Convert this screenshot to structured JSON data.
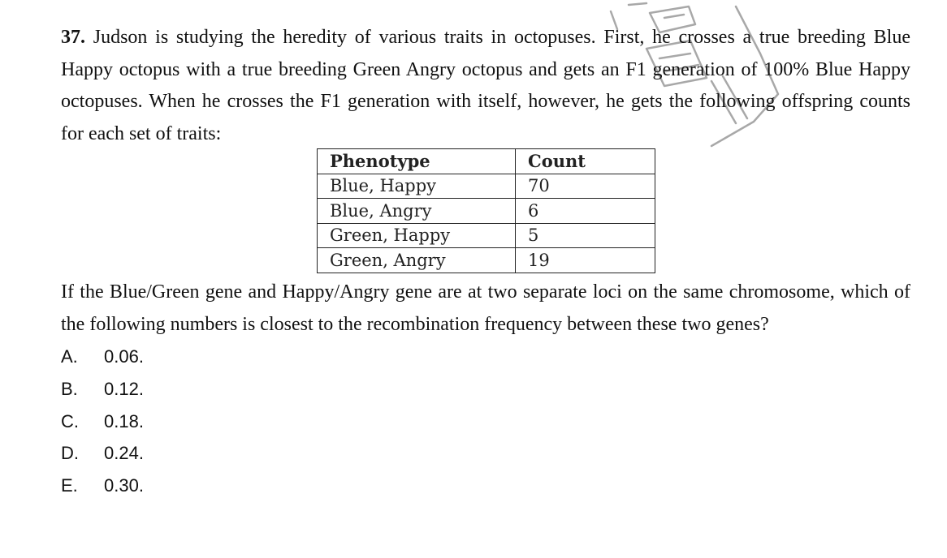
{
  "question": {
    "number": "37.",
    "text": " Judson is studying the heredity of various traits in octopuses. First, he crosses a true breeding Blue Happy octopus with a true breeding Green Angry octopus and gets an F1 generation of 100% Blue Happy octopuses. When he crosses the F1 generation with itself, however, he gets the following offspring counts for each set of traits:"
  },
  "table": {
    "headers": [
      "Phenotype",
      "Count"
    ],
    "rows": [
      [
        "Blue, Happy",
        "70"
      ],
      [
        "Blue, Angry",
        "6"
      ],
      [
        "Green, Happy",
        "5"
      ],
      [
        "Green, Angry",
        "19"
      ]
    ]
  },
  "followup": "If the Blue/Green gene and Happy/Angry gene are at two separate loci on the same chromosome, which of the following numbers is closest to the recombination frequency between these two genes?",
  "choices": [
    {
      "letter": "A.",
      "value": "0.06."
    },
    {
      "letter": "B.",
      "value": "0.12."
    },
    {
      "letter": "C.",
      "value": "0.18."
    },
    {
      "letter": "D.",
      "value": "0.24."
    },
    {
      "letter": "E.",
      "value": "0.30."
    }
  ],
  "watermark": {
    "icon": "stamp-watermark-icon",
    "color": "#9a9a9a"
  }
}
